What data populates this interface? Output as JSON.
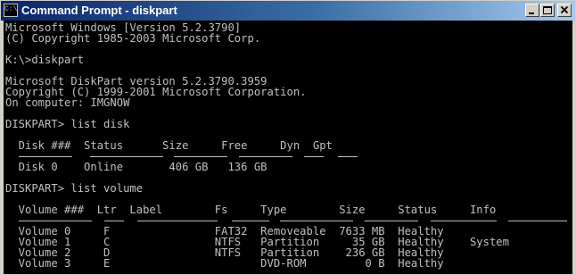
{
  "window": {
    "title": "Command Prompt - diskpart",
    "icon_label": "C:\\",
    "controls": [
      "minimize-icon",
      "maximize-icon",
      "close-icon"
    ]
  },
  "console": {
    "lines": [
      "Microsoft Windows [Version 5.2.3790]",
      "(C) Copyright 1985-2003 Microsoft Corp.",
      "",
      "K:\\>diskpart",
      "",
      "Microsoft DiskPart version 5.2.3790.3959",
      "Copyright (C) 1999-2001 Microsoft Corporation.",
      "On computer: IMGNOW",
      "",
      "DISKPART> list disk",
      "",
      "  Disk ###  Status      Size     Free     Dyn  Gpt",
      "",
      "  Disk 0    Online       406 GB   136 GB",
      "",
      "DISKPART> list volume",
      "",
      "  Volume ###  Ltr  Label        Fs     Type        Size     Status     Info",
      "",
      "  Volume 0     F                FAT32  Removeable  7633 MB  Healthy",
      "  Volume 1     C                NTFS   Partition     35 GB  Healthy    System",
      "  Volume 2     D                NTFS   Partition    236 GB  Healthy",
      "  Volume 3     E                       DVD-ROM         0 B  Healthy"
    ]
  },
  "colors": {
    "console_bg": "#000000",
    "console_text": "#c0c0c0",
    "titlebar_start": "#0a246a",
    "titlebar_end": "#a6caf0"
  }
}
